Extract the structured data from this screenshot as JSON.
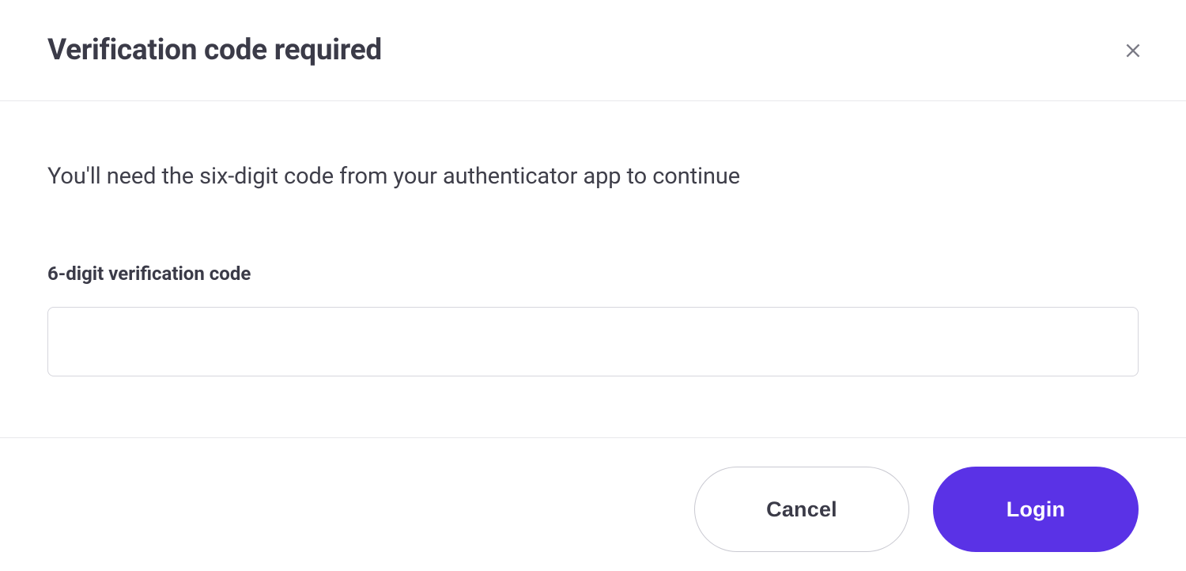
{
  "header": {
    "title": "Verification code required"
  },
  "body": {
    "instructions": "You'll need the six-digit code from your authenticator app to continue",
    "field_label": "6-digit verification code",
    "code_value": ""
  },
  "footer": {
    "cancel_label": "Cancel",
    "login_label": "Login"
  },
  "colors": {
    "accent": "#5a32e6",
    "text_primary": "#3b3b48",
    "border": "#d6d6dd"
  }
}
